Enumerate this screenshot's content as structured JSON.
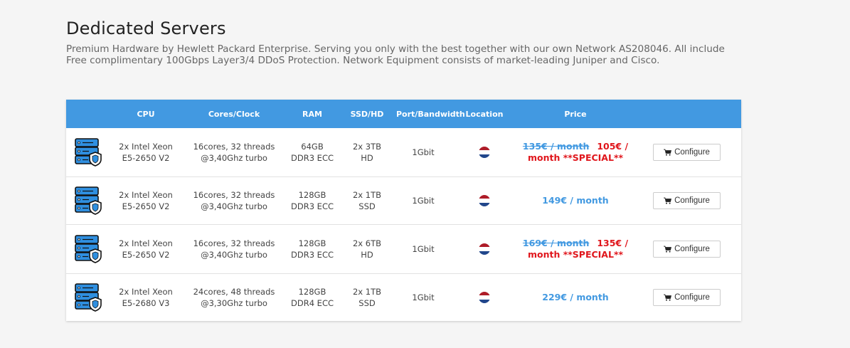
{
  "header": {
    "title": "Dedicated Servers",
    "subtitle": "Premium Hardware by Hewlett Packard Enterprise. Serving you only with the best together with our own Network AS208046. All include Free complimentary 100Gbps Layer3/4 DDoS Protection. Network Equipment consists of market-leading Juniper and Cisco."
  },
  "table": {
    "columns": {
      "cpu": "CPU",
      "cores": "Cores/Clock",
      "ram": "RAM",
      "ssd": "SSD/HD",
      "port": "Port/Bandwidth",
      "location": "Location",
      "price": "Price"
    },
    "rows": [
      {
        "cpu_line1": "2x Intel Xeon",
        "cpu_line2": "E5-2650 V2",
        "cores_line1": "16cores, 32 threads",
        "cores_line2": "@3,40Ghz turbo",
        "ram_line1": "64GB",
        "ram_line2": "DDR3 ECC",
        "ssd_line1": "2x 3TB",
        "ssd_line2": "HD",
        "port": "1Gbit",
        "location_flag": "netherlands-flag-icon",
        "old_price": "135€ / month",
        "special_price": "105€ / month **SPECIAL**",
        "price": "",
        "button_label": "Configure"
      },
      {
        "cpu_line1": "2x Intel Xeon",
        "cpu_line2": "E5-2650 V2",
        "cores_line1": "16cores, 32 threads",
        "cores_line2": "@3,40Ghz turbo",
        "ram_line1": "128GB",
        "ram_line2": "DDR3 ECC",
        "ssd_line1": "2x 1TB",
        "ssd_line2": "SSD",
        "port": "1Gbit",
        "location_flag": "netherlands-flag-icon",
        "old_price": "",
        "special_price": "",
        "price": "149€ / month",
        "button_label": "Configure"
      },
      {
        "cpu_line1": "2x Intel Xeon",
        "cpu_line2": "E5-2650 V2",
        "cores_line1": "16cores, 32 threads",
        "cores_line2": "@3,40Ghz turbo",
        "ram_line1": "128GB",
        "ram_line2": "DDR3 ECC",
        "ssd_line1": "2x 6TB",
        "ssd_line2": "HD",
        "port": "1Gbit",
        "location_flag": "netherlands-flag-icon",
        "old_price": "169€ / month",
        "special_price": "135€ / month **SPECIAL**",
        "price": "",
        "button_label": "Configure"
      },
      {
        "cpu_line1": "2x Intel Xeon",
        "cpu_line2": "E5-2680 V3",
        "cores_line1": "24cores, 48 threads",
        "cores_line2": "@3,30Ghz turbo",
        "ram_line1": "128GB",
        "ram_line2": "DDR4 ECC",
        "ssd_line1": "2x 1TB",
        "ssd_line2": "SSD",
        "port": "1Gbit",
        "location_flag": "netherlands-flag-icon",
        "old_price": "",
        "special_price": "",
        "price": "229€ / month",
        "button_label": "Configure"
      }
    ]
  },
  "colors": {
    "accent": "#4299e1",
    "special": "#e0161c",
    "server_icon_blue": "#2f8fe0"
  },
  "icons": {
    "row_icon": "server-shield-icon",
    "button_icon": "shopping-cart-icon"
  }
}
